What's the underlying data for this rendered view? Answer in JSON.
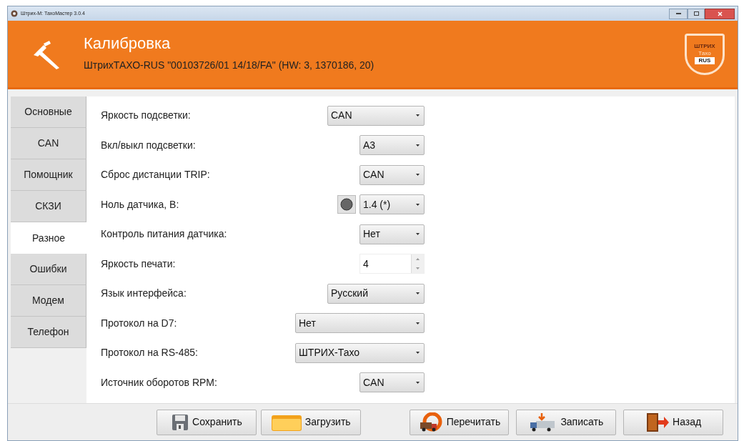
{
  "window": {
    "title": "Штрих-М: ТахоМастер 3.0.4"
  },
  "header": {
    "title": "Калибровка",
    "subtitle": "ШтрихТАХО-RUS \"00103726/01 14/18/FA\" (HW: 3, 1370186, 20)",
    "logo": [
      "ШТРИХ",
      "Тахо",
      "RUS"
    ]
  },
  "tabs": [
    {
      "label": "Основные",
      "selected": false
    },
    {
      "label": "CAN",
      "selected": false
    },
    {
      "label": "Помощник",
      "selected": false
    },
    {
      "label": "СКЗИ",
      "selected": false
    },
    {
      "label": "Разное",
      "selected": true
    },
    {
      "label": "Ошибки",
      "selected": false
    },
    {
      "label": "Модем",
      "selected": false
    },
    {
      "label": "Телефон",
      "selected": false
    }
  ],
  "settings": [
    {
      "label": "Яркость подсветки:",
      "kind": "combo",
      "value": "CAN"
    },
    {
      "label": "Вкл/выкл подсветки:",
      "kind": "combo",
      "value": "A3"
    },
    {
      "label": "Сброс дистанции TRIP:",
      "kind": "combo",
      "value": "CAN"
    },
    {
      "label": "Ноль датчика, В:",
      "kind": "combo",
      "value": "1.4 (*)",
      "indicator_on": false
    },
    {
      "label": "Контроль питания датчика:",
      "kind": "combo",
      "value": "Нет"
    },
    {
      "label": "Яркость печати:",
      "kind": "spin",
      "value": "4"
    },
    {
      "label": "Язык интерфейса:",
      "kind": "combo",
      "value": "Русский"
    },
    {
      "label": "Протокол на D7:",
      "kind": "combo",
      "value": "Нет"
    },
    {
      "label": "Протокол на RS-485:",
      "kind": "combo",
      "value": "ШТРИХ-Тахо"
    },
    {
      "label": "Источник оборотов RPM:",
      "kind": "combo",
      "value": "CAN"
    }
  ],
  "buttons": [
    {
      "label": "Сохранить",
      "kind": "save"
    },
    {
      "label": "Загрузить",
      "kind": "load"
    },
    {
      "label": "Перечитать",
      "kind": "reload"
    },
    {
      "label": "Записать",
      "kind": "write"
    },
    {
      "label": "Назад",
      "kind": "back"
    }
  ]
}
